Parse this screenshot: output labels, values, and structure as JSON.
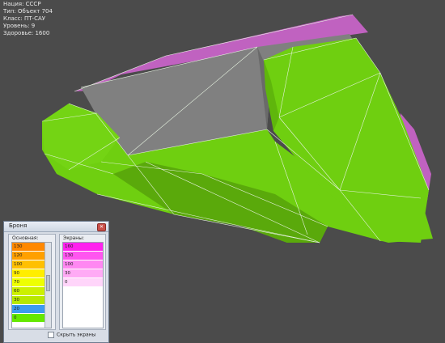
{
  "info": {
    "nation": "Нация: СССР",
    "type": "Тип: Объект 704",
    "class": "Класс: ПТ-САУ",
    "levels": "Уровень: 9",
    "health": "Здоровье: 1600"
  },
  "colors": {
    "background": "#4b4b4b",
    "hull_green": "#6fcf10",
    "hull_green_dark": "#55a80b",
    "gun_grey": "#7d7d7d",
    "screen_purple": "#c062c0"
  },
  "armor_window": {
    "title": "Броня",
    "close_icon": "close-icon",
    "base_label": "Основная:",
    "screens_label": "Экраны:",
    "base_rows": [
      {
        "value": "130",
        "color": "#ff8800"
      },
      {
        "value": "120",
        "color": "#ffa000"
      },
      {
        "value": "100",
        "color": "#ffc000"
      },
      {
        "value": "90",
        "color": "#ffee00"
      },
      {
        "value": "70",
        "color": "#eeff00"
      },
      {
        "value": "60",
        "color": "#ccf000"
      },
      {
        "value": "30",
        "color": "#b8e800"
      },
      {
        "value": "20",
        "color": "#3d9bf0"
      },
      {
        "value": "0",
        "color": "#66e800"
      }
    ],
    "screen_rows": [
      {
        "value": "160",
        "color": "#ff22ee"
      },
      {
        "value": "130",
        "color": "#ff55f0"
      },
      {
        "value": "100",
        "color": "#ff88f2"
      },
      {
        "value": "30",
        "color": "#ffaaf5"
      },
      {
        "value": "0",
        "color": "#ffd5fa"
      }
    ],
    "hide_screens_label": "Скрыть экраны"
  }
}
